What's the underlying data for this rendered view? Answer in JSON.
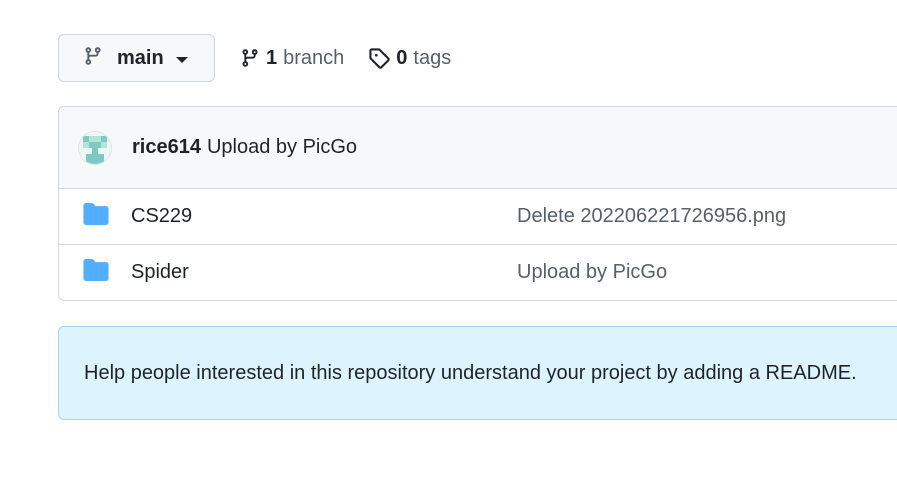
{
  "branch_selector": {
    "current_branch": "main",
    "icon": "git-branch-icon"
  },
  "branches": {
    "count": "1",
    "label": "branch",
    "icon": "git-branch-icon"
  },
  "tags": {
    "count": "0",
    "label": "tags",
    "icon": "tag-icon"
  },
  "latest_commit": {
    "author": "rice614",
    "message": "Upload by PicGo"
  },
  "files": [
    {
      "name": "CS229",
      "type": "folder",
      "commit_message": "Delete 202206221726956.png"
    },
    {
      "name": "Spider",
      "type": "folder",
      "commit_message": "Upload by PicGo"
    }
  ],
  "readme_banner": {
    "text": "Help people interested in this repository understand your project by adding a README."
  },
  "colors": {
    "folder": "#54aeff",
    "banner_bg": "#ddf4ff",
    "muted_text": "#57606a",
    "border": "#d0d7de"
  }
}
